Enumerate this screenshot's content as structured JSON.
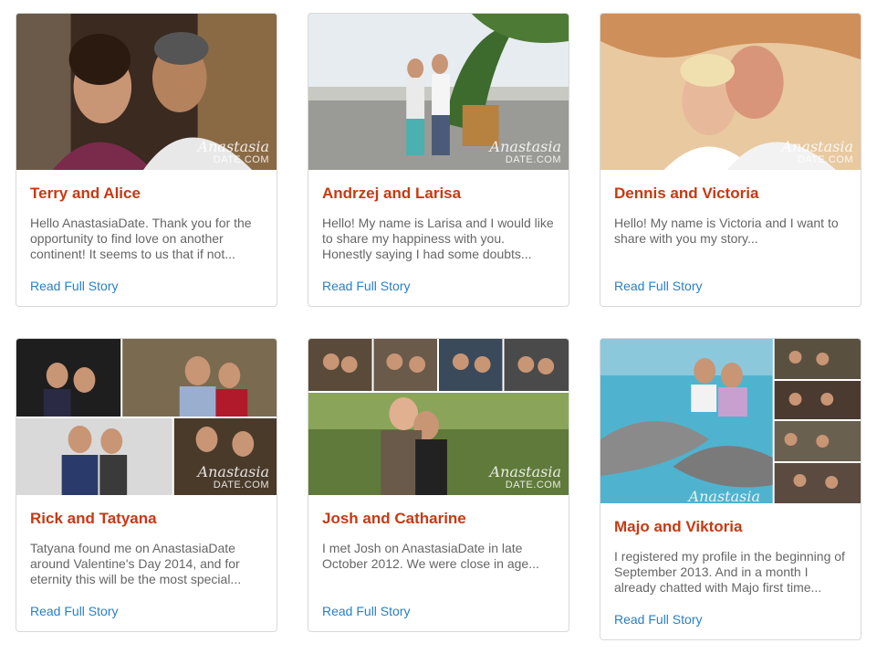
{
  "watermark": {
    "brand": "Anastasia",
    "domain": "DATE.COM"
  },
  "read_more_label": "Read Full Story",
  "stories": [
    {
      "title": "Terry and Alice",
      "excerpt": "Hello AnastasiaDate. Thank you for the opportunity to find love on another continent! It seems to us that if not..."
    },
    {
      "title": "Andrzej and Larisa",
      "excerpt": "Hello! My name is Larisa and I would like to share my happiness with you. Honestly saying I had some doubts..."
    },
    {
      "title": "Dennis and Victoria",
      "excerpt": "Hello! My name is Victoria and I want to share with you my story..."
    },
    {
      "title": "Rick and Tatyana",
      "excerpt": "Tatyana found me on AnastasiaDate around Valentine's Day 2014, and for eternity this will be the most special..."
    },
    {
      "title": "Josh and Catharine",
      "excerpt": "I met Josh on AnastasiaDate in late October 2012. We were close in age..."
    },
    {
      "title": "Majo and Viktoria",
      "excerpt": "I registered my profile in the beginning of September 2013. And in a month I already chatted with Majo first time..."
    }
  ],
  "colors": {
    "title": "#c63a12",
    "link": "#2a7fc4",
    "text": "#666666",
    "border": "#d9d9d9"
  }
}
